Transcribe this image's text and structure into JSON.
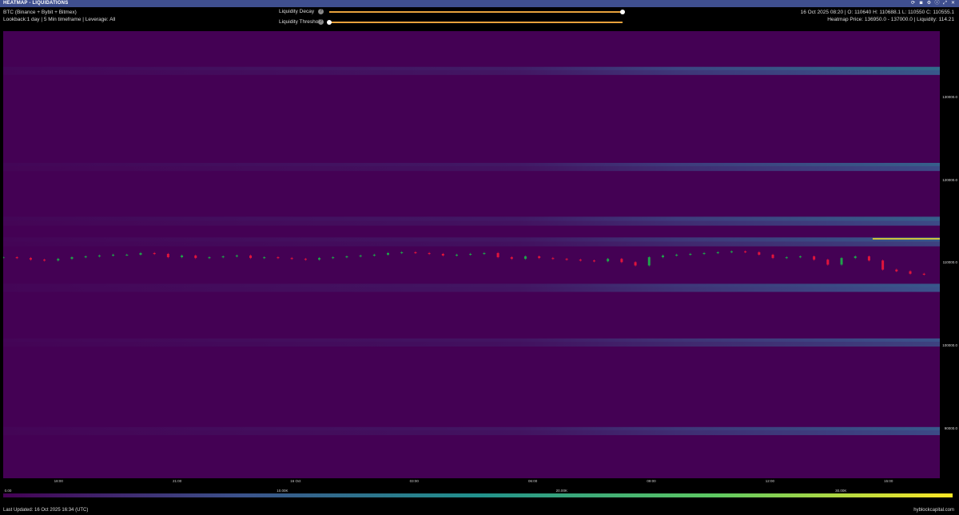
{
  "panel": {
    "title": "HEATMAP - LIQUIDATIONS",
    "icons": [
      "refresh-icon",
      "camera-icon",
      "settings-icon",
      "info-icon",
      "expand-icon",
      "close-icon"
    ]
  },
  "info_left": {
    "symbol": "BTC (Binance + Bybit + Bitmex)",
    "params": "Lookback:1 day | 5 Min timeframe | Leverage: All"
  },
  "info_right": {
    "ohlc": "16 Oct 2025 08:20 | O: 110640 H: 110688.1 L: 110550 C: 110555.1",
    "heatmap": "Heatmap Price: 136950.0 - 137000.0 | Liquidity: 114.21"
  },
  "controls": {
    "decay_label": "Liquidity Decay",
    "threshold_label": "Liquidity Threshold",
    "decay_value": 1.0,
    "threshold_value": 0.0,
    "accent": "#e8a23c"
  },
  "chart_data": {
    "type": "heatmap",
    "price_ticks": [
      "130000.0",
      "120000.0",
      "110000.0",
      "100000.0",
      "90000.0"
    ],
    "price_tick_values": [
      130000,
      120000,
      110000,
      100000,
      90000
    ],
    "ylim": [
      84000,
      138000
    ],
    "time_ticks": [
      "18:00",
      "21:00",
      "16 Oct",
      "03:00",
      "06:00",
      "09:00",
      "12:00",
      "15:00"
    ],
    "time_tick_hours": [
      18,
      21,
      24,
      27,
      30,
      33,
      36,
      39
    ],
    "xlim_hours": [
      16.6,
      40.3
    ],
    "liquidity_levels": [
      {
        "price": 133400,
        "intensity": 0.7
      },
      {
        "price": 133000,
        "intensity": 0.55
      },
      {
        "price": 121800,
        "intensity": 0.6
      },
      {
        "price": 121400,
        "intensity": 0.45
      },
      {
        "price": 115300,
        "intensity": 0.6
      },
      {
        "price": 114800,
        "intensity": 0.45
      },
      {
        "price": 112800,
        "intensity": 0.55
      },
      {
        "price": 112300,
        "intensity": 0.4
      },
      {
        "price": 107200,
        "intensity": 0.55
      },
      {
        "price": 106800,
        "intensity": 0.5
      },
      {
        "price": 100600,
        "intensity": 0.5
      },
      {
        "price": 100200,
        "intensity": 0.4
      },
      {
        "price": 89900,
        "intensity": 0.55
      },
      {
        "price": 89500,
        "intensity": 0.45
      }
    ],
    "highlight_level": {
      "price": 112900,
      "intensity": 1.0
    },
    "candles": {
      "start_hour": 16.6,
      "end_hour": 39.9,
      "closes": [
        110700,
        110600,
        110400,
        110300,
        110500,
        110700,
        110800,
        110900,
        111000,
        111000,
        111200,
        111100,
        110700,
        110900,
        110600,
        110700,
        110800,
        110900,
        110600,
        110700,
        110600,
        110500,
        110400,
        110600,
        110700,
        110800,
        110900,
        111000,
        111200,
        111300,
        111200,
        111100,
        110900,
        111000,
        111100,
        111200,
        110700,
        110500,
        110800,
        110600,
        110500,
        110400,
        110300,
        110200,
        110500,
        110100,
        109700,
        110700,
        110900,
        111000,
        111100,
        111200,
        111300,
        111400,
        111300,
        111000,
        110600,
        110700,
        110800,
        110400,
        109800,
        110600,
        110800,
        110300,
        109200,
        109000,
        108700,
        108600
      ]
    }
  },
  "colorbar": {
    "labels": [
      "0.00",
      "10.00K",
      "20.00K",
      "30.00K"
    ],
    "min": 0,
    "max": 34000,
    "colors": [
      "#440154",
      "#3b528b",
      "#21918c",
      "#5ec962",
      "#fde725"
    ]
  },
  "footer": {
    "updated": "Last Updated: 16 Oct 2025 16:34 (UTC)",
    "brand": "hyblockcapital.com"
  },
  "colors": {
    "background": "#440154",
    "up": "#1fa34a",
    "down": "#e0143c",
    "header": "#3f4f8f"
  }
}
